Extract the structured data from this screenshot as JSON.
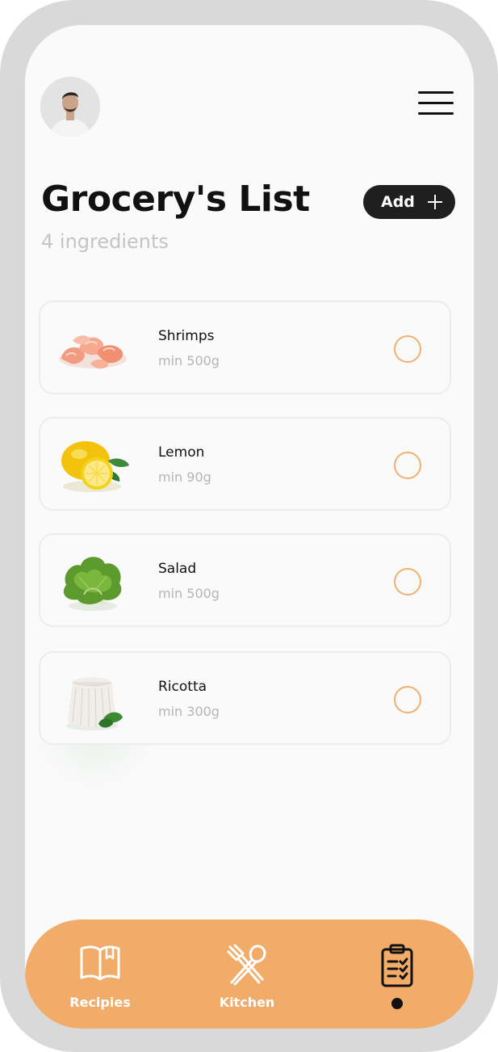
{
  "header": {
    "avatar_alt": "User avatar"
  },
  "page": {
    "title": "Grocery's List",
    "subtitle": "4 ingredients"
  },
  "add_button": {
    "label": "Add"
  },
  "items": [
    {
      "name": "Shrimps",
      "qty": "min 500g",
      "icon": "shrimps-image",
      "checked": false
    },
    {
      "name": "Lemon",
      "qty": "min 90g",
      "icon": "lemon-image",
      "checked": false
    },
    {
      "name": "Salad",
      "qty": "min 500g",
      "icon": "salad-image",
      "checked": false
    },
    {
      "name": "Ricotta",
      "qty": "min 300g",
      "icon": "ricotta-image",
      "checked": false
    }
  ],
  "nav": {
    "items": [
      {
        "label": "Recipies",
        "icon": "book-icon"
      },
      {
        "label": "Kitchen",
        "icon": "fork-spoon-icon"
      },
      {
        "label": "",
        "icon": "clipboard-checklist-icon",
        "active": true
      }
    ]
  },
  "colors": {
    "accent": "#f2ac69",
    "check_ring": "#f2b06f",
    "dark": "#1f1f1f",
    "frame": "#d9d9d9"
  }
}
